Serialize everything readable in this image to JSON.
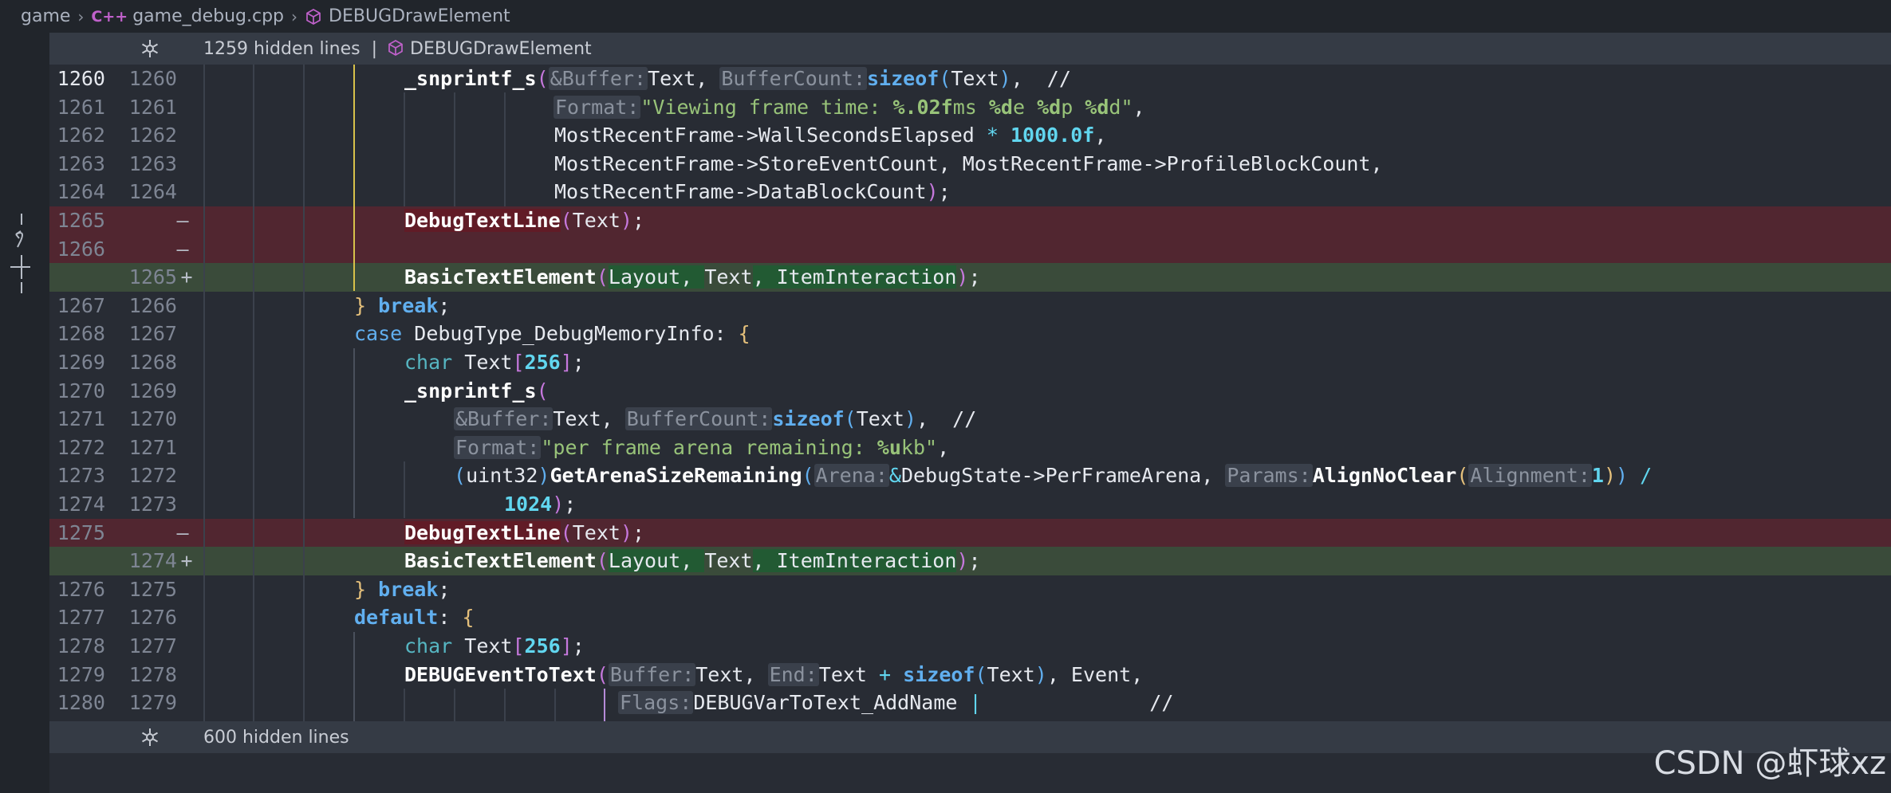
{
  "breadcrumb": {
    "root": "game",
    "file": "game_debug.cpp",
    "file_icon": "C++",
    "symbol": "DEBUGDrawElement"
  },
  "hidden_top": {
    "text": "1259 hidden lines  |",
    "symbol": "DEBUGDrawElement"
  },
  "hidden_bottom": {
    "text": "600 hidden lines"
  },
  "diff_lines": [
    {
      "old": "1260",
      "new": "1260",
      "marker": ""
    },
    {
      "old": "1261",
      "new": "1261",
      "marker": ""
    },
    {
      "old": "1262",
      "new": "1262",
      "marker": ""
    },
    {
      "old": "1263",
      "new": "1263",
      "marker": ""
    },
    {
      "old": "1264",
      "new": "1264",
      "marker": ""
    },
    {
      "old": "1265",
      "new": "",
      "marker": "—"
    },
    {
      "old": "1266",
      "new": "",
      "marker": "—"
    },
    {
      "old": "",
      "new": "1265",
      "marker": "+"
    },
    {
      "old": "1267",
      "new": "1266",
      "marker": ""
    },
    {
      "old": "1268",
      "new": "1267",
      "marker": ""
    },
    {
      "old": "1269",
      "new": "1268",
      "marker": ""
    },
    {
      "old": "1270",
      "new": "1269",
      "marker": ""
    },
    {
      "old": "1271",
      "new": "1270",
      "marker": ""
    },
    {
      "old": "1272",
      "new": "1271",
      "marker": ""
    },
    {
      "old": "1273",
      "new": "1272",
      "marker": ""
    },
    {
      "old": "1274",
      "new": "1273",
      "marker": ""
    },
    {
      "old": "1275",
      "new": "",
      "marker": "—"
    },
    {
      "old": "",
      "new": "1274",
      "marker": "+"
    },
    {
      "old": "1276",
      "new": "1275",
      "marker": ""
    },
    {
      "old": "1277",
      "new": "1276",
      "marker": ""
    },
    {
      "old": "1278",
      "new": "1277",
      "marker": ""
    },
    {
      "old": "1279",
      "new": "1278",
      "marker": ""
    },
    {
      "old": "1280",
      "new": "1279",
      "marker": ""
    }
  ],
  "code": {
    "l1260": {
      "fn": "_snprintf_s",
      "p": "(",
      "h1": "&Buffer:",
      "a1": "Text, ",
      "h2": "BufferCount:",
      "sz": "sizeof",
      "p2": "(",
      "a2": "Text",
      "p3": ")",
      "tail": ",  //"
    },
    "l1261": {
      "h": "Format:",
      "s1": "\"Viewing frame time: ",
      "f1": "%.02f",
      "s2": "ms ",
      "f2": "%d",
      "s3": "e ",
      "f3": "%d",
      "s4": "p ",
      "f4": "%d",
      "s5": "d\"",
      "tail": ","
    },
    "l1262": {
      "a": "MostRecentFrame->WallSecondsElapsed ",
      "op": "*",
      "n": " 1000.0f",
      "tail": ","
    },
    "l1263": {
      "a": "MostRecentFrame->StoreEventCount, MostRecentFrame->ProfileBlockCount,"
    },
    "l1264": {
      "a": "MostRecentFrame->DataBlockCount",
      "p": ")",
      "tail": ";"
    },
    "l1265d": {
      "fn": "DebugTextLine",
      "p": "(",
      "a": "Text",
      "p2": ")",
      "tail": ";"
    },
    "l1265a": {
      "fn": "BasicTextElement",
      "p": "(",
      "a1": "Layout, ",
      "a2": "Text",
      "a3": ", ItemInteraction",
      "p2": ")",
      "tail": ";"
    },
    "l1267": {
      "b": "}",
      "kw": " break",
      "tail": ";"
    },
    "l1268": {
      "kw": "case",
      "a": " DebugType_DebugMemoryInfo: ",
      "b": "{"
    },
    "l1269": {
      "ty": "char",
      "a": " Text",
      "p": "[",
      "n": "256",
      "p2": "]",
      "tail": ";"
    },
    "l1270": {
      "fn": "_snprintf_s",
      "p": "("
    },
    "l1271": {
      "h1": "&Buffer:",
      "a1": "Text, ",
      "h2": "BufferCount:",
      "sz": "sizeof",
      "p": "(",
      "a2": "Text",
      "p2": ")",
      "tail": ",  //"
    },
    "l1272": {
      "h": "Format:",
      "s1": "\"per frame arena remaining: ",
      "f1": "%u",
      "s2": "kb\"",
      "tail": ","
    },
    "l1273": {
      "p": "(",
      "ty": "uint32",
      "p2": ")",
      "fn": "GetArenaSizeRemaining",
      "p3": "(",
      "h1": "Arena:",
      "amp": "&",
      "a1": "DebugState->PerFrameArena, ",
      "h2": "Params:",
      "fn2": "AlignNoClear",
      "p4": "(",
      "h3": "Alignment:",
      "n": "1",
      "p5": ")",
      "p6": ")",
      "op": " /"
    },
    "l1274": {
      "n": "1024",
      "p": ")",
      "tail": ";"
    },
    "l1275d": {
      "fn": "DebugTextLine",
      "p": "(",
      "a": "Text",
      "p2": ")",
      "tail": ";"
    },
    "l1274a": {
      "fn": "BasicTextElement",
      "p": "(",
      "a1": "Layout, ",
      "a2": "Text",
      "a3": ", ItemInteraction",
      "p2": ")",
      "tail": ";"
    },
    "l1276": {
      "b": "}",
      "kw": " break",
      "tail": ";"
    },
    "l1277": {
      "kw": "default",
      "a": ": ",
      "b": "{"
    },
    "l1278": {
      "ty": "char",
      "a": " Text",
      "p": "[",
      "n": "256",
      "p2": "]",
      "tail": ";"
    },
    "l1279": {
      "fn": "DEBUGEventToText",
      "p": "(",
      "h1": "Buffer:",
      "a1": "Text, ",
      "h2": "End:",
      "a2": "Text ",
      "op": "+",
      "sz": " sizeof",
      "p2": "(",
      "a3": "Text",
      "p3": ")",
      "tail": ", Event,"
    },
    "l1280": {
      "h": "Flags:",
      "a": "DEBUGVarToText_AddName ",
      "op": "|",
      "tail": "              //"
    }
  },
  "gutter_icons": [
    "revert-icon",
    "stage-line-icon"
  ],
  "watermark": "CSDN @虾球xz",
  "colors": {
    "deleted_bg": "#512630",
    "added_bg": "#3a4b3a",
    "editor_bg": "#282c34",
    "accent_yellow": "#e5c07b"
  }
}
